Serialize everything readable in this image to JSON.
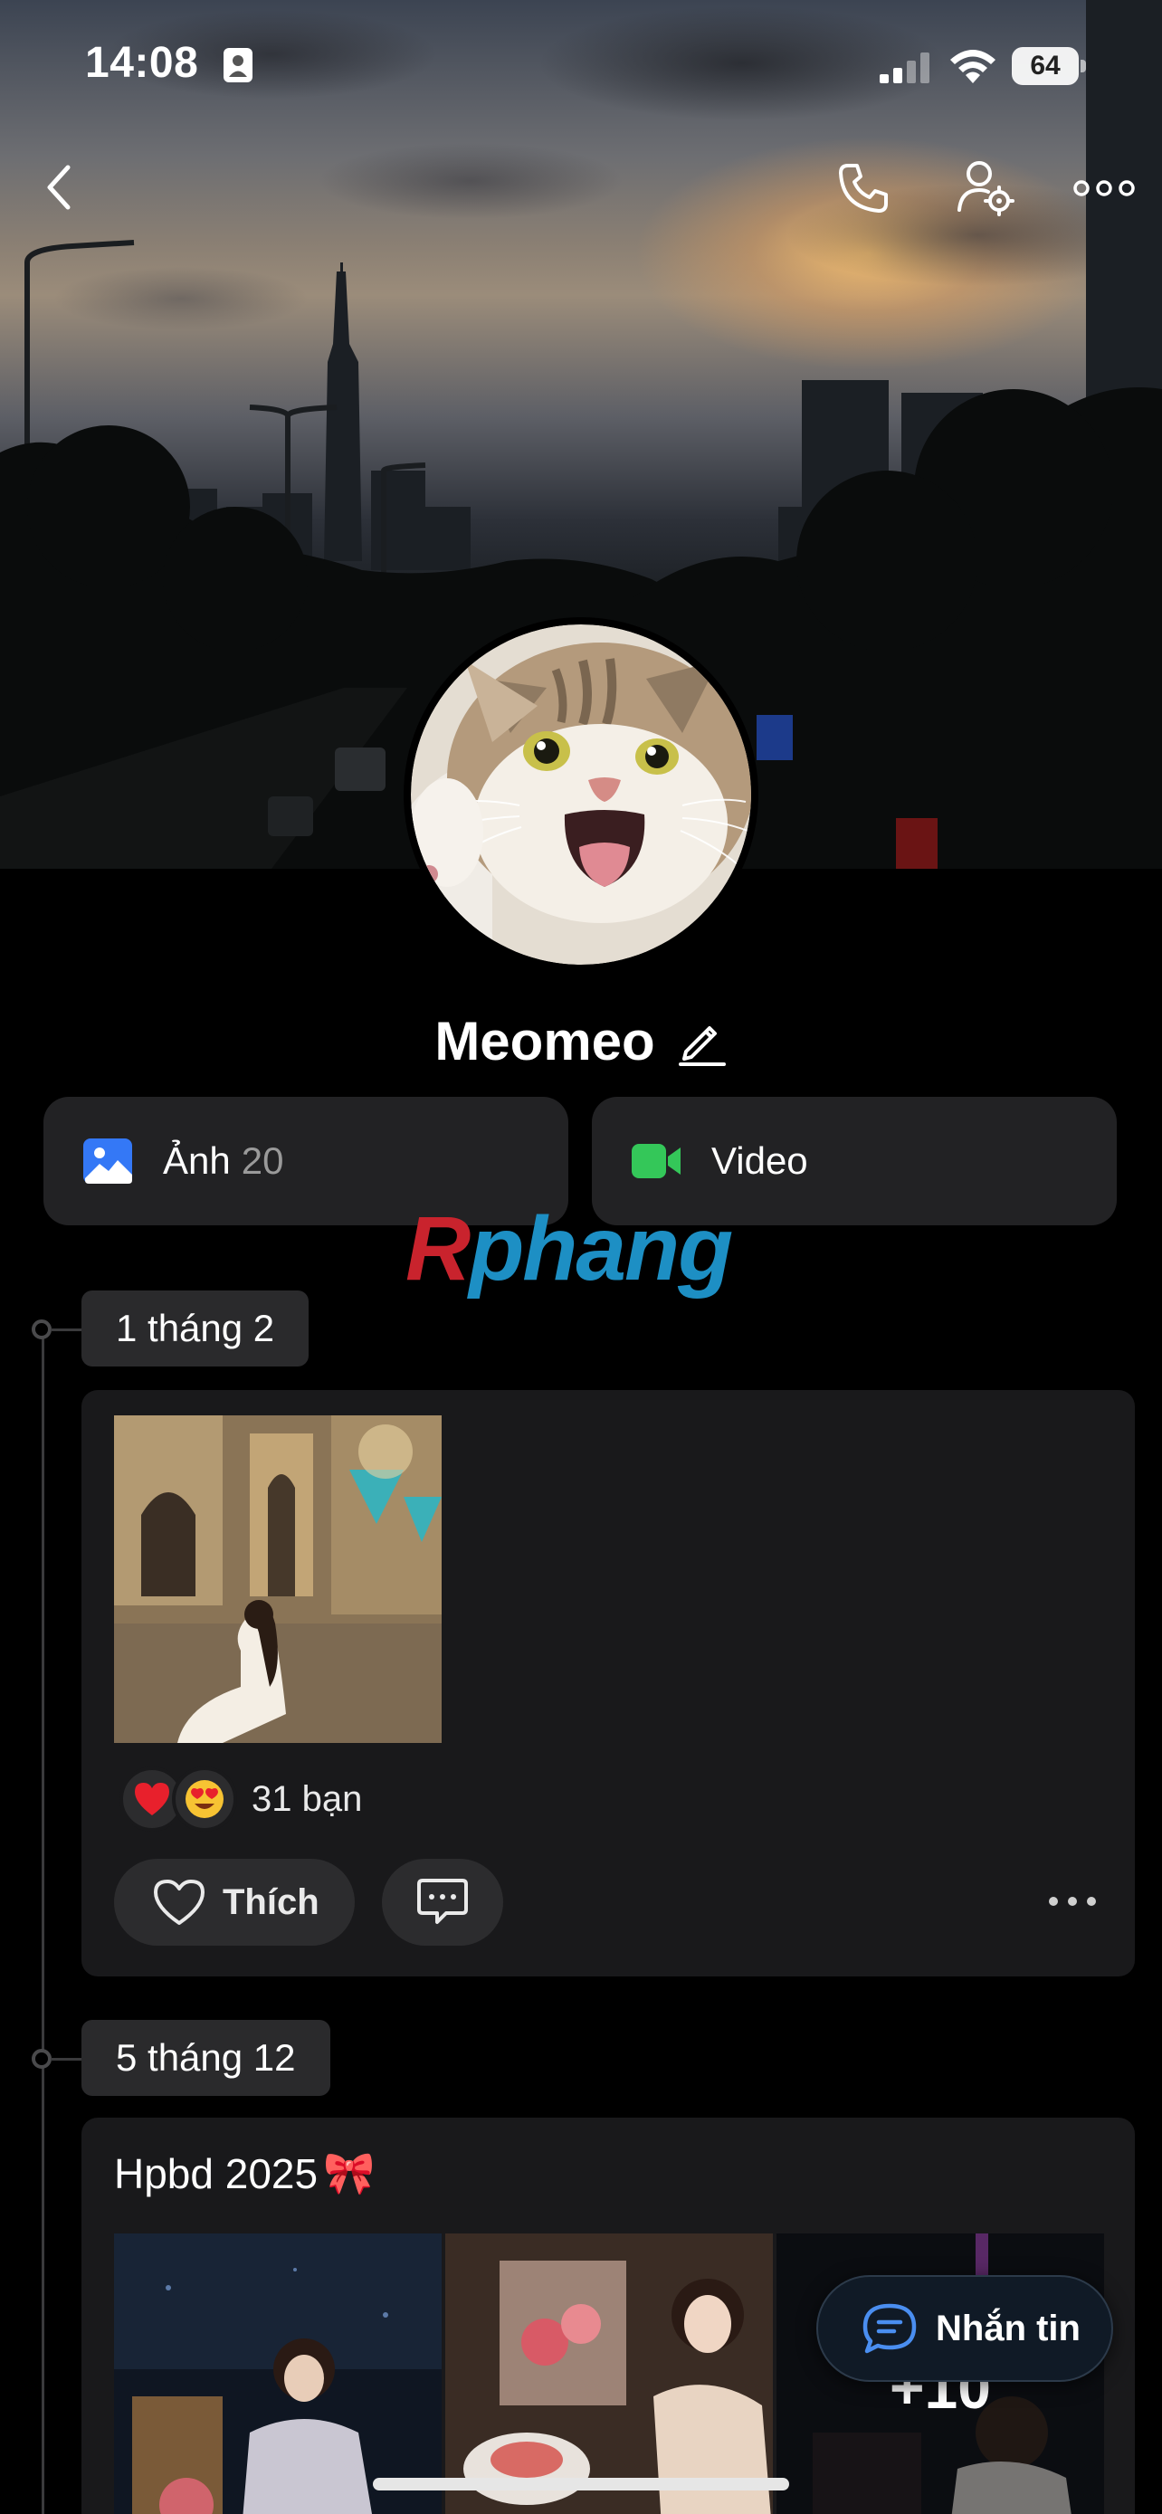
{
  "status_bar": {
    "time": "14:08",
    "battery": "64",
    "icons": [
      "contact-card-icon",
      "signal-icon",
      "wifi-icon",
      "battery-icon"
    ]
  },
  "nav": {
    "icons": [
      "back-icon",
      "phone-icon",
      "profile-settings-icon",
      "more-icon"
    ]
  },
  "profile": {
    "name": "Meomeo",
    "edit_icon": "pencil-icon"
  },
  "media": {
    "photos_label": "Ảnh",
    "photos_count": "20",
    "video_label": "Video",
    "photos_color": "#3478f6",
    "video_color": "#34c759"
  },
  "watermark": {
    "first": "R",
    "rest": "phang"
  },
  "timeline": [
    {
      "date": "1 tháng 2",
      "reaction_count": "31 bạn",
      "reactions": [
        "heart-icon",
        "heart-eyes-icon"
      ],
      "like_label": "Thích"
    },
    {
      "date": "5 tháng 12",
      "title": "Hpbd 2025",
      "title_emoji": "🎀",
      "more_count": "+10"
    }
  ],
  "message_button": {
    "label": "Nhắn tin"
  }
}
